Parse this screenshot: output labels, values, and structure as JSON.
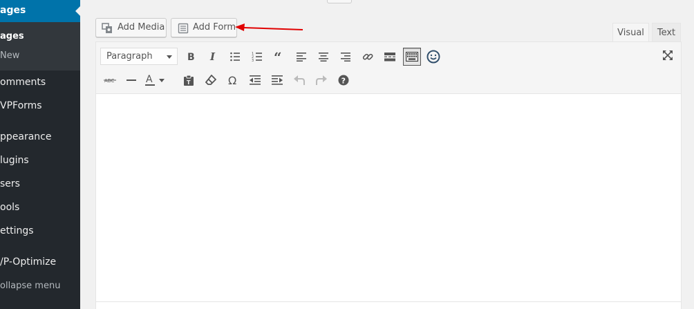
{
  "sidebar": {
    "current_menu": "ages",
    "submenu": [
      {
        "label": "ages",
        "current": true
      },
      {
        "label": "New",
        "current": false
      }
    ],
    "items": [
      {
        "label": "omments",
        "icon": "comments-icon"
      },
      {
        "label": "VPForms",
        "icon": "wpforms-icon"
      },
      {
        "label": "ppearance",
        "icon": "appearance-icon"
      },
      {
        "label": "lugins",
        "icon": "plugins-icon"
      },
      {
        "label": "sers",
        "icon": "users-icon"
      },
      {
        "label": "ools",
        "icon": "tools-icon"
      },
      {
        "label": "ettings",
        "icon": "settings-icon"
      },
      {
        "label": "/P-Optimize",
        "icon": "wp-optimize-icon"
      }
    ],
    "collapse_label": "ollapse menu"
  },
  "media_buttons": {
    "add_media": "Add Media",
    "add_form": "Add Form"
  },
  "annotation": {
    "arrow_color": "#e00000"
  },
  "tabs": {
    "visual": "Visual",
    "text": "Text",
    "active": "visual"
  },
  "toolbar": {
    "format_select": "Paragraph",
    "row1": [
      "bold-icon",
      "italic-icon",
      "bulleted-list-icon",
      "numbered-list-icon",
      "blockquote-icon",
      "align-left-icon",
      "align-center-icon",
      "align-right-icon",
      "link-icon",
      "read-more-icon",
      "toolbar-toggle-icon",
      "emoji-icon"
    ],
    "row2": [
      "strikethrough-icon",
      "horizontal-line-icon",
      "text-color-icon",
      "paste-as-text-icon",
      "clear-formatting-icon",
      "special-character-icon",
      "outdent-icon",
      "indent-icon",
      "undo-icon",
      "redo-icon",
      "help-icon"
    ],
    "strikethrough_label": "ABC",
    "omega_symbol": "Ω",
    "text_color_letter": "A"
  },
  "colors": {
    "sidebar_bg": "#23282d",
    "sidebar_current": "#0073aa",
    "accent_arrow": "#e00000"
  }
}
